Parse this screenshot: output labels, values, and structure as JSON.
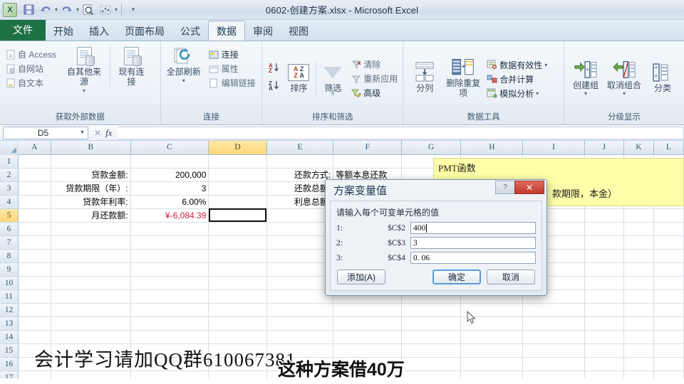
{
  "window": {
    "title": "0602-创建方案.xlsx - Microsoft Excel",
    "logo_text": "X",
    "quick_access": [
      {
        "name": "save-icon",
        "glyph": "💾"
      },
      {
        "name": "undo-icon",
        "glyph": "↶"
      },
      {
        "name": "redo-icon",
        "glyph": "↷"
      },
      {
        "name": "print-preview-icon",
        "glyph": "🔍"
      },
      {
        "name": "chart-icon",
        "glyph": "⁛"
      },
      {
        "name": "customize-qat-icon",
        "glyph": "▾"
      }
    ]
  },
  "tabs": {
    "file": "文件",
    "items": [
      "开始",
      "插入",
      "页面布局",
      "公式",
      "数据",
      "审阅",
      "视图"
    ],
    "active": "数据"
  },
  "ribbon": {
    "groups": [
      {
        "title": "获取外部数据",
        "small_commands": [
          "自 Access",
          "自网站",
          "自文本"
        ],
        "big_commands": [
          "自其他来源",
          "现有连接"
        ]
      },
      {
        "title": "连接",
        "big_commands": [
          "全部刷新"
        ],
        "small_commands": [
          "连接",
          "属性",
          "编辑链接"
        ]
      },
      {
        "title": "排序和筛选",
        "big_commands": [
          "排序",
          "筛选"
        ],
        "small_commands": [
          "清除",
          "重新应用",
          "高级"
        ],
        "sort_az": "A\nZ",
        "sort_za": "Z\nA"
      },
      {
        "title": "数据工具",
        "big_commands": [
          "分列",
          "删除重复项"
        ],
        "small_commands": [
          "数据有效性",
          "合并计算",
          "模拟分析"
        ]
      },
      {
        "title": "分级显示",
        "big_commands": [
          "创建组",
          "取消组合",
          "分类"
        ]
      }
    ]
  },
  "formula_bar": {
    "name_box": "D5",
    "formula": "",
    "cancel_icon": "✕",
    "enter_icon": "✓",
    "fx_icon": "fx"
  },
  "sheet": {
    "columns": [
      "A",
      "B",
      "C",
      "D",
      "E",
      "F",
      "G",
      "H",
      "I",
      "J",
      "K",
      "L"
    ],
    "selected_column": "D",
    "rows": [
      1,
      2,
      3,
      4,
      5,
      6,
      7,
      8,
      9,
      10,
      11,
      12,
      13,
      14,
      15,
      16,
      17
    ],
    "selected_row": 5,
    "selected_cell": "D5",
    "cells": {
      "B2": "贷款金额:",
      "C2": "200,000",
      "E2": "还款方式:",
      "F2": "等额本息还款",
      "B3": "贷款期限（年）:",
      "C3": "3",
      "E3": "还款总额:",
      "B4": "贷款年利率:",
      "C4": "6.00%",
      "E4": "利息总额:",
      "B5": "月还款额:",
      "C5": "¥-6,084.39",
      "D5": ""
    },
    "note": {
      "line1": "PMT函数",
      "line2": "款期限，本金）"
    }
  },
  "dialog": {
    "title": "方案变量值",
    "help_icon": "?",
    "close_icon": "✕",
    "prompt": "请输入每个可变单元格的值",
    "rows": [
      {
        "index": "1:",
        "ref": "$C$2",
        "value": "400"
      },
      {
        "index": "2:",
        "ref": "$C$3",
        "value": "3"
      },
      {
        "index": "3:",
        "ref": "$C$4",
        "value": "0. 06"
      }
    ],
    "buttons": {
      "add": "添加(A)",
      "ok": "确定",
      "cancel": "取消"
    }
  },
  "subtitles": {
    "line1": "会计学习请加QQ群610067381",
    "line2": "这种方案借40万"
  }
}
